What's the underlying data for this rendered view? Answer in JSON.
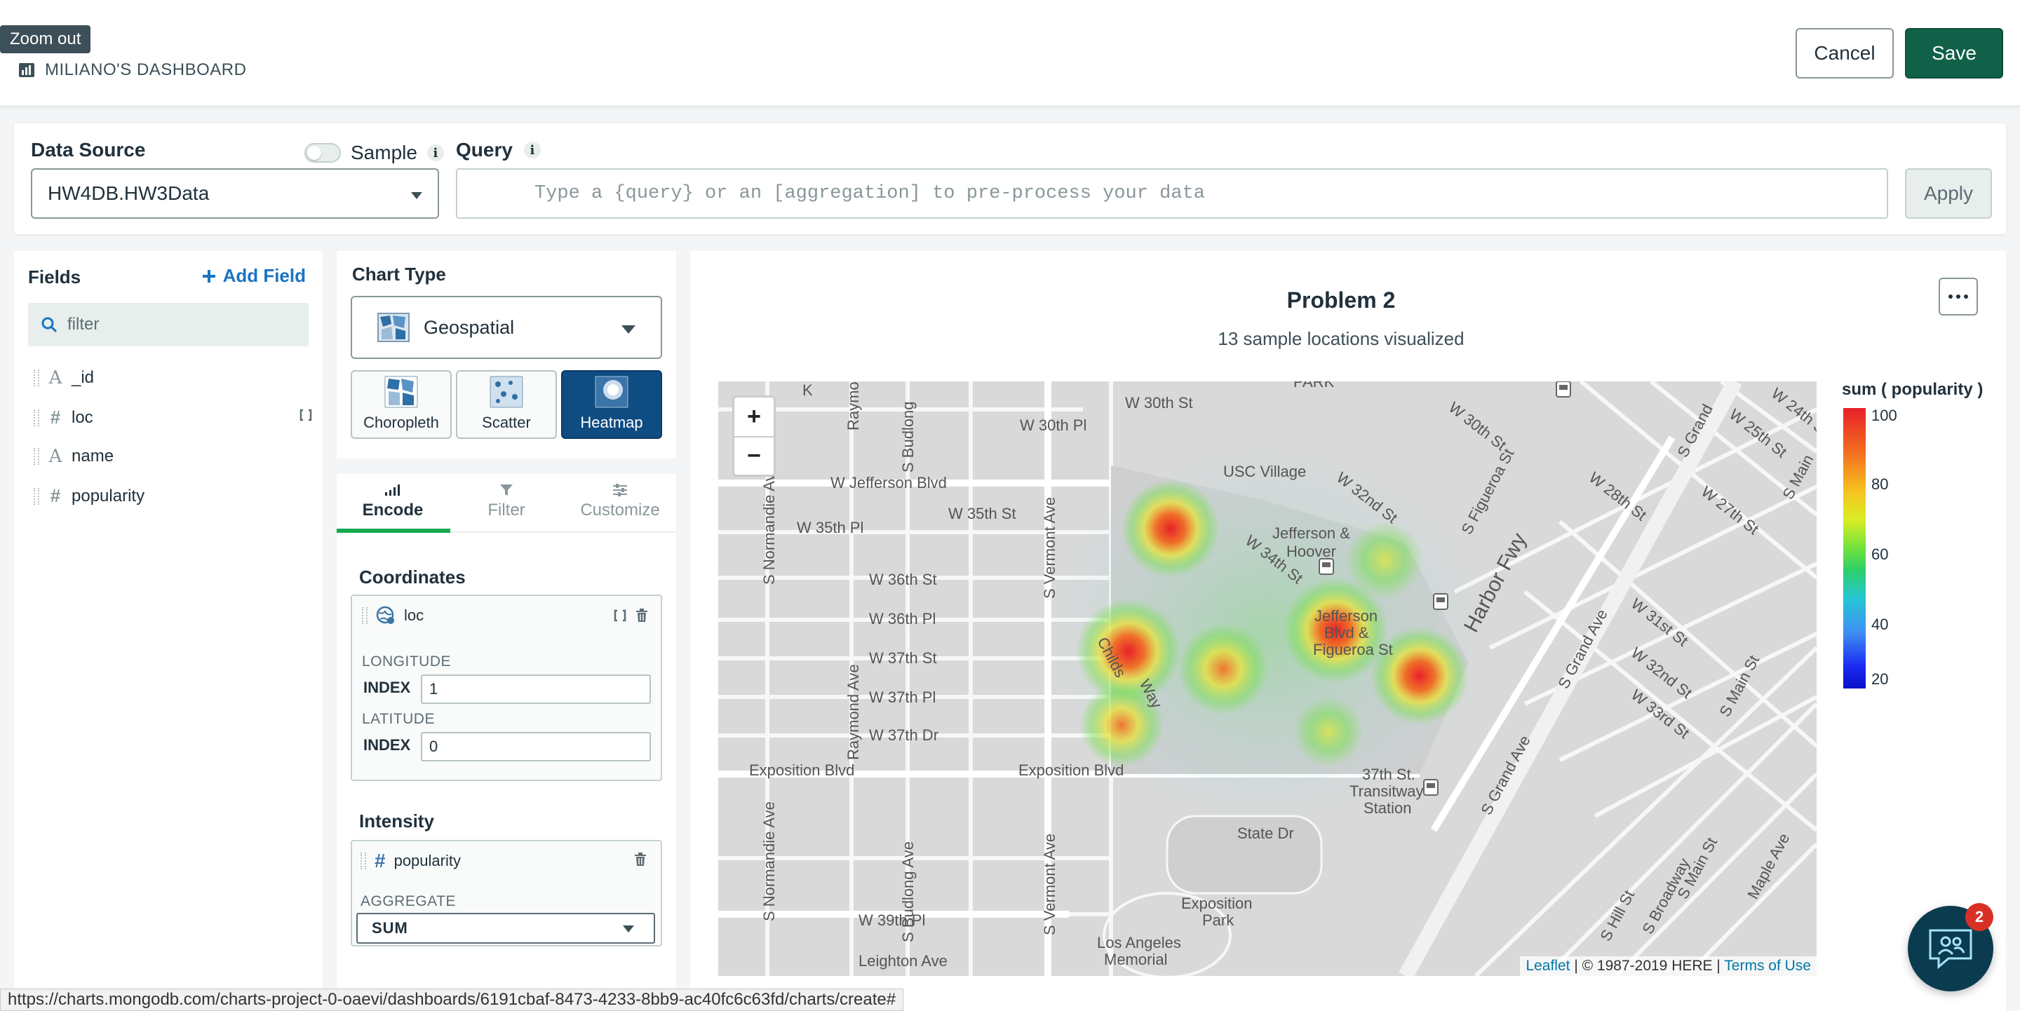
{
  "header": {
    "title": "art",
    "tooltip": "Zoom out",
    "dashboard": "MILIANO'S DASHBOARD",
    "cancel": "Cancel",
    "save": "Save"
  },
  "datasource": {
    "label": "Data Source",
    "sample_label": "Sample",
    "selected": "HW4DB.HW3Data",
    "query_label": "Query",
    "query_placeholder": "Type a {query} or an [aggregation] to pre-process your data",
    "apply": "Apply"
  },
  "fields": {
    "title": "Fields",
    "add_field": "Add Field",
    "filter_placeholder": "filter",
    "items": [
      {
        "type": "A",
        "name": "_id"
      },
      {
        "type": "#",
        "name": "loc"
      },
      {
        "type": "A",
        "name": "name"
      },
      {
        "type": "#",
        "name": "popularity"
      }
    ]
  },
  "chart_type": {
    "title": "Chart Type",
    "selected": "Geospatial",
    "subtypes": [
      "Choropleth",
      "Scatter",
      "Heatmap"
    ],
    "active_subtype": "Heatmap"
  },
  "encode": {
    "tabs": [
      "Encode",
      "Filter",
      "Customize"
    ],
    "active_tab": "Encode",
    "coordinates": {
      "title": "Coordinates",
      "field": "loc",
      "longitude_label": "LONGITUDE",
      "longitude_index_label": "INDEX",
      "longitude_index": "1",
      "latitude_label": "LATITUDE",
      "latitude_index_label": "INDEX",
      "latitude_index": "0"
    },
    "intensity": {
      "title": "Intensity",
      "field": "popularity",
      "aggregate_label": "AGGREGATE",
      "aggregate": "SUM"
    }
  },
  "chart": {
    "title": "Problem 2",
    "subtitle": "13 sample locations visualized",
    "legend_title": "sum ( popularity )",
    "legend_ticks": [
      "100",
      "80",
      "60",
      "40",
      "20"
    ],
    "zoom_in": "+",
    "zoom_out": "−",
    "attribution_leaflet": "Leaflet",
    "attribution_text": " | © 1987-2019 HERE | ",
    "attribution_terms": "Terms of Use",
    "map_labels": {
      "park": "PARK",
      "w30th": "W 30th St",
      "w30thpl": "W 30th Pl",
      "w30thst_r": "W 30th St",
      "jefferson": "W Jefferson Blvd",
      "usc": "USC Village",
      "jh": "Jefferson &",
      "jh2": "Hoover",
      "w32nd": "W 32nd St",
      "w34th": "W 34th St",
      "w35thst": "W 35th St",
      "w35thpl": "W 35th Pl",
      "w36thst": "W 36th St",
      "w36thpl": "W 36th Pl",
      "w37thst": "W 37th St",
      "w37thpl": "W 37th Pl",
      "w37thdr": "W 37th Dr",
      "childs": "Childs",
      "way": "Way",
      "jf1": "Jefferson",
      "jf2": "Blvd &",
      "jf3": "Figueroa St",
      "expo1": "Exposition  Blvd",
      "expo2": "Exposition  Blvd",
      "st37_1": "37th St.",
      "st37_2": "Transitway",
      "st37_3": "Station",
      "statedr": "State Dr",
      "expopark1": "Exposition",
      "expopark2": "Park",
      "memorial1": "Los Angeles",
      "memorial2": "Memorial",
      "w39th": "W 39th Pl",
      "leighton": "Leighton Ave",
      "harbor": "Harbor Fwy",
      "figueroa": "S Figueroa St",
      "vermont": "S Vermont Ave",
      "vermont2": "S Vermont Ave",
      "normandie": "S Normandie Ave",
      "normandie2": "S Normandie Ave",
      "budlong": "S Budlong",
      "budlong2": "S Budlong Ave",
      "raymond": "Raymond Ave",
      "raymond2": "Raymond Ave",
      "grand": "S Grand Ave",
      "grand2": "S Grand Ave",
      "w28th": "W 28th St",
      "w27th": "W 27th St",
      "w25th": "W 25th St",
      "w24th": "W 24th St",
      "w31st": "W 31st St",
      "w32nd_r": "W 32nd St",
      "w33rd": "W 33rd St",
      "mainst": "S Main St",
      "mainst2": "S Main St",
      "hill": "S Hill St",
      "broadway": "S Broadway",
      "maple": "Maple Ave",
      "grand_top": "S Grand",
      "main_top": "S Main",
      "ray_top": "Raymo",
      "budlong_top": "S Budlong",
      "k": "K"
    }
  },
  "status_url": "https://charts.mongodb.com/charts-project-0-oaevi/dashboards/6191cbaf-8473-4233-8bb9-ac40fc6c63fd/charts/create#",
  "chat_badge": "2"
}
